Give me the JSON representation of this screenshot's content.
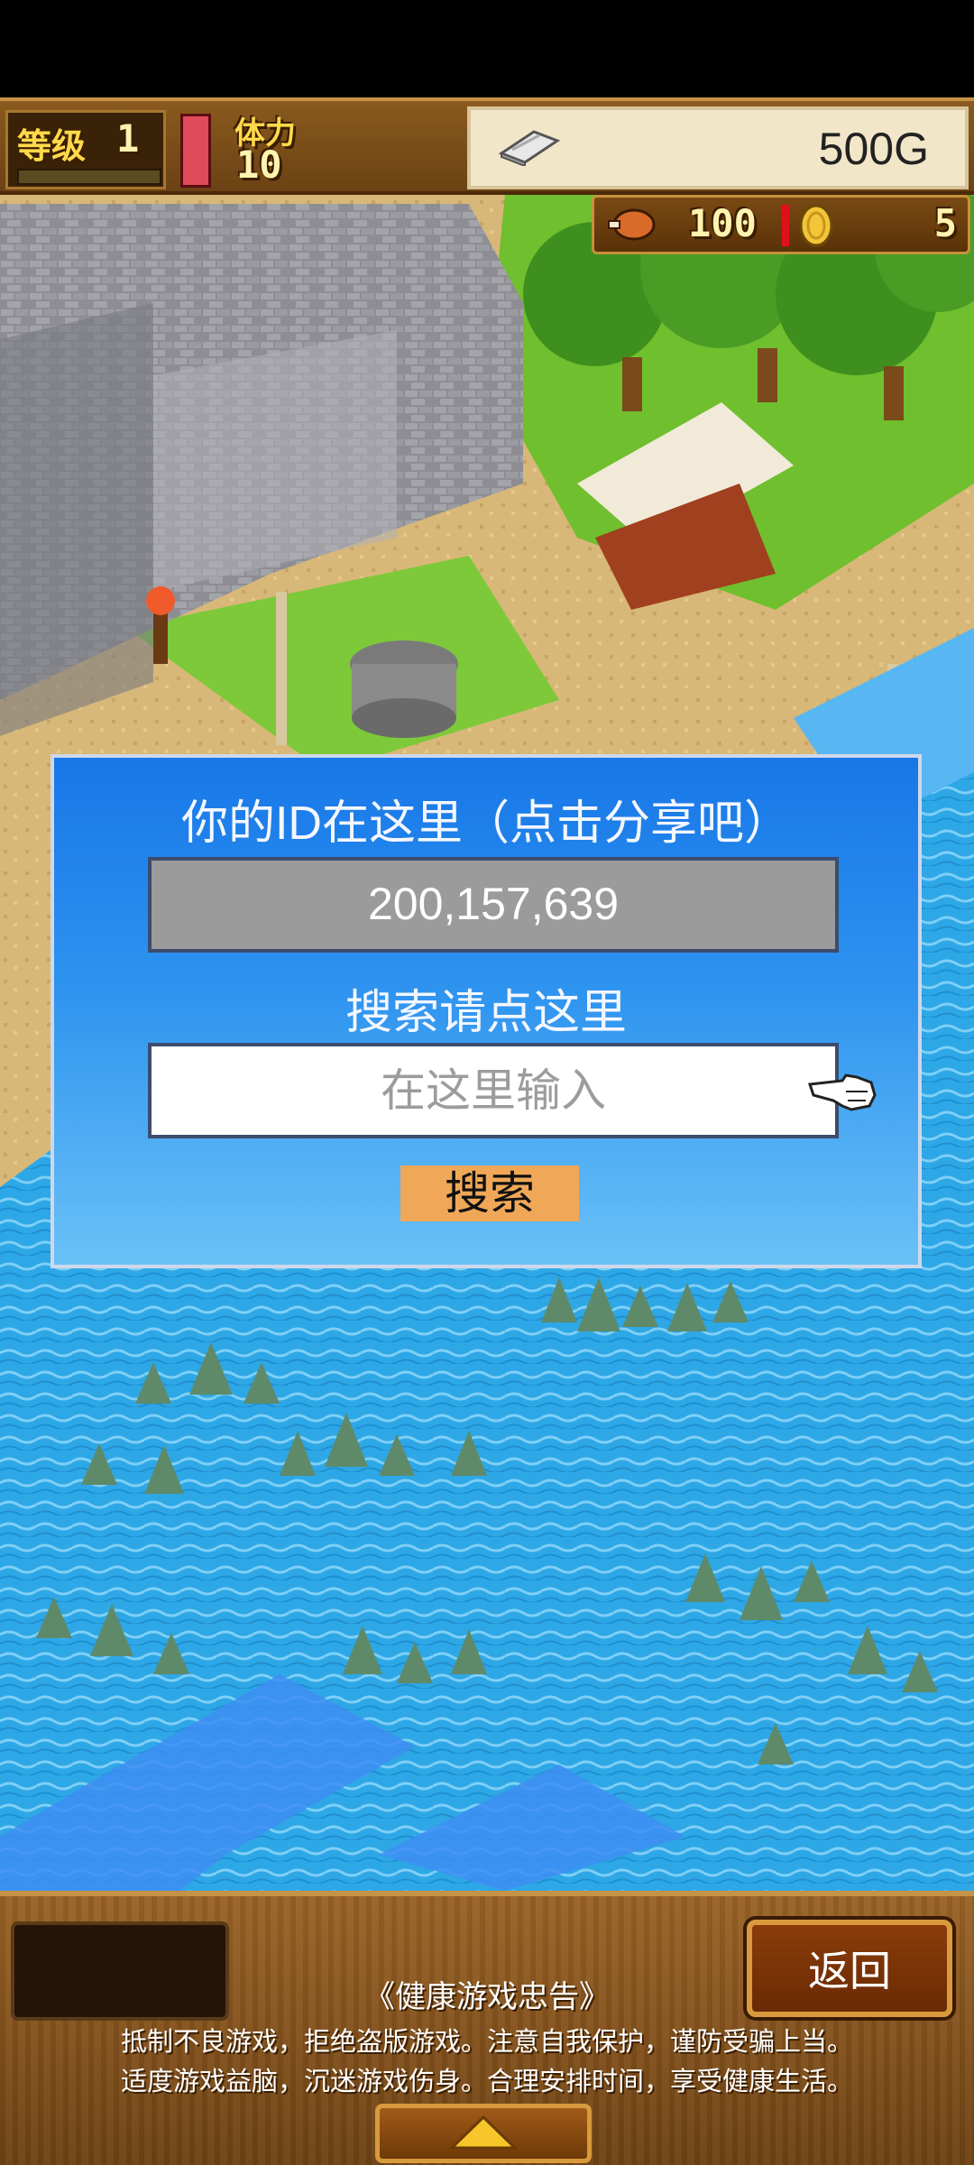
{
  "hud": {
    "level_label": "等级",
    "level_value": "1",
    "stamina_label": "体力",
    "stamina_value": "10",
    "gold_value": "500G",
    "food_value": "100",
    "coin_value": "5"
  },
  "dialog": {
    "title": "你的ID在这里（点击分享吧）",
    "id_value": "200,157,639",
    "search_hint": "搜索请点这里",
    "search_placeholder": "在这里输入",
    "search_button": "搜索"
  },
  "bottom": {
    "back_button": "返回",
    "health_title": "《健康游戏忠告》",
    "health_line1": "抵制不良游戏，拒绝盗版游戏。注意自我保护，谨防受骗上当。",
    "health_line2": "适度游戏益脑，沉迷游戏伤身。合理安排时间，享受健康生活。"
  },
  "colors": {
    "dialog_top": "#1877e8",
    "dialog_bottom": "#6ac1f7",
    "search_button": "#f0a858",
    "sea": "#2da8e8",
    "grass": "#6fbf2e"
  },
  "icons": [
    "silver-bar-icon",
    "food-icon",
    "gold-coin-icon",
    "pointing-hand-icon",
    "up-arrow-icon"
  ]
}
